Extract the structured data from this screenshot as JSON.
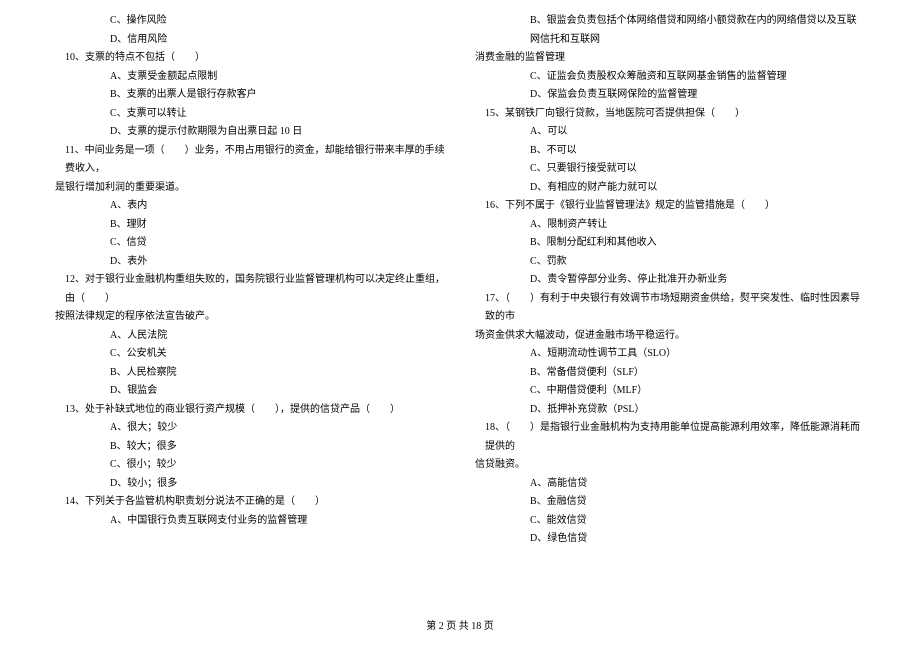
{
  "col1": {
    "q9_optC": "C、操作风险",
    "q9_optD": "D、信用风险",
    "q10": "10、支票的特点不包括（　　）",
    "q10_A": "A、支票受金额起点限制",
    "q10_B": "B、支票的出票人是银行存款客户",
    "q10_C": "C、支票可以转让",
    "q10_D": "D、支票的提示付款期限为自出票日起 10 日",
    "q11_l1": "11、中间业务是一项（　　）业务，不用占用银行的资金，却能给银行带来丰厚的手续费收入，",
    "q11_l2": "是银行增加利润的重要渠道。",
    "q11_A": "A、表内",
    "q11_B": "B、理财",
    "q11_C": "C、信贷",
    "q11_D": "D、表外",
    "q12_l1": "12、对于银行业金融机构重组失败的，国务院银行业监督管理机构可以决定终止重组，由（　　）",
    "q12_l2": "按照法律规定的程序依法宣告破产。",
    "q12_A": "A、人民法院",
    "q12_B": "C、公安机关",
    "q12_C": "B、人民检察院",
    "q12_D": "D、银监会",
    "q13": "13、处于补缺式地位的商业银行资产规模（　　），提供的信贷产品（　　）",
    "q13_A": "A、很大；较少",
    "q13_B": "B、较大；很多",
    "q13_C": "C、很小；较少",
    "q13_D": "D、较小；很多",
    "q14": "14、下列关于各监管机构职责划分说法不正确的是（　　）",
    "q14_A": "A、中国银行负责互联网支付业务的监督管理"
  },
  "col2": {
    "q14_B_l1": "B、银监会负责包括个体网络借贷和网络小额贷款在内的网络借贷以及互联网信托和互联网",
    "q14_B_l2": "消费金融的监督管理",
    "q14_C": "C、证监会负责股权众筹融资和互联网基金销售的监督管理",
    "q14_D": "D、保监会负责互联网保险的监督管理",
    "q15": "15、某钢铁厂向银行贷款，当地医院可否提供担保（　　）",
    "q15_A": "A、可以",
    "q15_B": "B、不可以",
    "q15_C": "C、只要银行接受就可以",
    "q15_D": "D、有相应的财产能力就可以",
    "q16": "16、下列不属于《银行业监督管理法》规定的监管措施是（　　）",
    "q16_A": "A、限制资产转让",
    "q16_B": "B、限制分配红利和其他收入",
    "q16_C": "C、罚款",
    "q16_D": "D、责令暂停部分业务、停止批准开办新业务",
    "q17_l1": "17、（　　）有利于中央银行有效调节市场短期资金供给，熨平突发性、临时性因素导致的市",
    "q17_l2": "场资金供求大幅波动，促进金融市场平稳运行。",
    "q17_A": "A、短期流动性调节工具（SLO）",
    "q17_B": "B、常备借贷便利（SLF）",
    "q17_C": "C、中期借贷便利（MLF）",
    "q17_D": "D、抵押补充贷款（PSL）",
    "q18_l1": "18、（　　）是指银行业金融机构为支持用能单位提高能源利用效率，降低能源消耗而提供的",
    "q18_l2": "信贷融资。",
    "q18_A": "A、高能信贷",
    "q18_B": "B、金融信贷",
    "q18_C": "C、能效信贷",
    "q18_D": "D、绿色信贷"
  },
  "footer": "第 2 页 共 18 页"
}
